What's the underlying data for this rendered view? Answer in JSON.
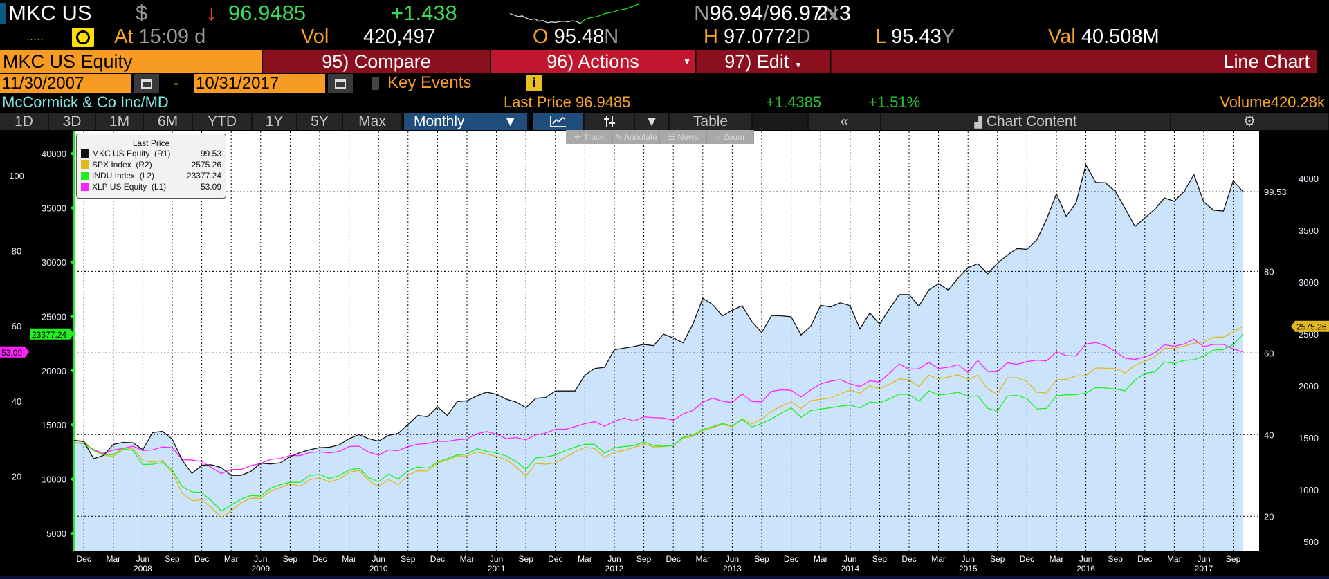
{
  "header": {
    "ticker": "MKC US",
    "currency": "$",
    "direction_arrow": "↓",
    "last": "96.9485",
    "change": "+1.438",
    "bid_ask_prefix": "N",
    "bid": "96.94",
    "sep": "/",
    "ask": "96.97",
    "bid_ask_suffix": "N",
    "size_a": "2",
    "size_x": "x",
    "size_b": "3",
    "dots": ".....",
    "at_label": "At",
    "time": "15:09",
    "time_flag": "d",
    "vol_label": "Vol",
    "vol": "420,497",
    "open_label": "O",
    "open": "95.48",
    "open_flag": "N",
    "high_label": "H",
    "high": "97.0772",
    "high_flag": "D",
    "low_label": "L",
    "low": "95.43",
    "low_flag": "Y",
    "val_label": "Val",
    "val": "40.508M",
    "sparkline": [
      10,
      9,
      8,
      8.5,
      7,
      6,
      6.5,
      5,
      5.5,
      4,
      4.5,
      4.2,
      4.8,
      5,
      4.6,
      5.2,
      4.9,
      3.5,
      6,
      7,
      7.5,
      8,
      9,
      10,
      10.5,
      11,
      12,
      12.5,
      13,
      14,
      15,
      16
    ]
  },
  "menu": {
    "security": "MKC US Equity",
    "compare": "95) Compare",
    "actions": "96) Actions",
    "edit": "97) Edit",
    "chart_type": "Line Chart"
  },
  "range": {
    "start": "11/30/2007",
    "dash": "-",
    "end": "10/31/2017",
    "key_events": "Key Events",
    "info": "i"
  },
  "summary": {
    "name": "McCormick & Co Inc/MD",
    "last_price_label": "Last Price",
    "last_price": "96.9485",
    "change": "+1.4385",
    "change_pct": "+1.51%",
    "volume_label": "Volume",
    "volume": "420.28k"
  },
  "toolbar": {
    "periods": [
      "1D",
      "3D",
      "1M",
      "6M",
      "YTD",
      "1Y",
      "5Y",
      "Max"
    ],
    "frequency": "Monthly",
    "table": "Table",
    "collapse": "«",
    "chart_content": "Chart Content"
  },
  "mini_toolbar": {
    "track": "Track",
    "annotate": "Annotate",
    "news": "News",
    "zoom": "Zoom"
  },
  "colors": {
    "mkc": "#111111",
    "spx": "#e0b820",
    "indu": "#22ee22",
    "xlp": "#ff22ff",
    "fill": "#cce4fb",
    "accent_orange": "#f89b22"
  },
  "chart_data": {
    "type": "line",
    "x_start": "2007-11",
    "frequency": "monthly",
    "x_tick_labels": [
      "Dec",
      "Mar",
      "Jun",
      "Sep",
      "Dec",
      "Mar",
      "Jun",
      "Sep",
      "Dec",
      "Mar",
      "Jun",
      "Sep",
      "Dec",
      "Mar",
      "Jun",
      "Sep",
      "Dec",
      "Mar",
      "Jun",
      "Sep",
      "Dec",
      "Mar",
      "Jun",
      "Sep",
      "Dec",
      "Mar",
      "Jun",
      "Sep",
      "Dec",
      "Mar",
      "Jun",
      "Sep",
      "Dec",
      "Mar",
      "Jun",
      "Sep",
      "Dec",
      "Mar",
      "Jun",
      "Sep"
    ],
    "year_labels": [
      "2008",
      "2009",
      "2010",
      "2011",
      "2012",
      "2013",
      "2014",
      "2015",
      "2016",
      "2017"
    ],
    "legend_title": "Last Price",
    "axes": {
      "L1": {
        "range": [
          0,
          111.8
        ],
        "ticks": [
          "20",
          "40",
          "60",
          "80",
          "100"
        ]
      },
      "L2": {
        "range": [
          3350,
          42040
        ],
        "ticks": [
          "5000",
          "10000",
          "15000",
          "20000",
          "25000",
          "30000",
          "35000",
          "40000"
        ]
      },
      "R1": {
        "range": [
          11.4,
          114.3
        ],
        "ticks": [
          "20",
          "40",
          "60",
          "80"
        ]
      },
      "R2": {
        "range": [
          407,
          4453
        ],
        "ticks": [
          "500",
          "1000",
          "1500",
          "2000",
          "2500",
          "3000",
          "3500",
          "4000"
        ]
      }
    },
    "series": [
      {
        "name": "MKC US Equity",
        "axis_label": "(R1)",
        "axis": "R1",
        "last": "99.53",
        "color_key": "mkc",
        "fill": true,
        "values": [
          38.6,
          38.3,
          34.1,
          34.9,
          37.6,
          38.1,
          38.0,
          36.3,
          40.5,
          40.8,
          38.9,
          33.8,
          30.5,
          32.5,
          32.6,
          31.9,
          30.0,
          30.0,
          31.0,
          33.0,
          32.8,
          33.1,
          34.6,
          35.6,
          36.3,
          36.8,
          36.9,
          37.5,
          39.0,
          40.0,
          39.0,
          38.4,
          39.8,
          40.3,
          42.5,
          44.7,
          44.4,
          46.8,
          44.7,
          48.1,
          48.3,
          49.5,
          50.4,
          49.9,
          48.7,
          48.0,
          46.6,
          48.9,
          49.1,
          50.7,
          50.7,
          50.7,
          54.6,
          56.2,
          56.5,
          60.8,
          61.2,
          61.6,
          62.1,
          61.8,
          64.6,
          63.7,
          62.5,
          67.1,
          73.4,
          71.9,
          69.1,
          70.5,
          71.6,
          67.7,
          65.0,
          69.2,
          69.1,
          68.9,
          64.4,
          66.6,
          71.7,
          71.3,
          72.3,
          71.6,
          65.9,
          69.8,
          67.1,
          70.8,
          74.3,
          74.3,
          71.5,
          75.4,
          77.0,
          75.4,
          78.4,
          80.9,
          81.9,
          79.4,
          82.0,
          84.0,
          85.6,
          85.4,
          87.7,
          92.8,
          99.0,
          93.5,
          96.8,
          106.1,
          101.8,
          101.7,
          99.6,
          95.4,
          91.0,
          93.1,
          95.2,
          98.0,
          97.2,
          99.6,
          103.7,
          97.0,
          95.0,
          94.8,
          102.2,
          99.53
        ]
      },
      {
        "name": "SPX Index",
        "axis_label": "(R2)",
        "axis": "R2",
        "last": "2575.26",
        "color_key": "spx",
        "values": [
          1481,
          1468,
          1379,
          1331,
          1323,
          1386,
          1400,
          1280,
          1267,
          1283,
          1165,
          969,
          896,
          903,
          826,
          735,
          798,
          873,
          919,
          919,
          987,
          1021,
          1057,
          1036,
          1096,
          1115,
          1074,
          1104,
          1169,
          1187,
          1089,
          1031,
          1102,
          1049,
          1141,
          1183,
          1181,
          1258,
          1286,
          1327,
          1326,
          1364,
          1345,
          1321,
          1292,
          1219,
          1131,
          1253,
          1247,
          1258,
          1312,
          1366,
          1408,
          1398,
          1310,
          1362,
          1379,
          1407,
          1441,
          1412,
          1416,
          1426,
          1498,
          1515,
          1569,
          1598,
          1631,
          1606,
          1686,
          1633,
          1682,
          1757,
          1806,
          1848,
          1783,
          1859,
          1872,
          1884,
          1924,
          1960,
          1931,
          2003,
          1972,
          2018,
          2068,
          2059,
          1995,
          2105,
          2068,
          2086,
          2107,
          2063,
          2104,
          1972,
          1920,
          2079,
          2080,
          2044,
          1940,
          1932,
          2060,
          2065,
          2097,
          2099,
          2174,
          2171,
          2168,
          2126,
          2199,
          2239,
          2279,
          2364,
          2363,
          2384,
          2412,
          2423,
          2470,
          2472,
          2519,
          2575.26
        ]
      },
      {
        "name": "INDU Index",
        "axis_label": "(L2)",
        "axis": "L2",
        "last": "23377.24",
        "color_key": "indu",
        "values": [
          13372,
          13265,
          12650,
          12266,
          12263,
          12820,
          12638,
          11350,
          11378,
          11544,
          10851,
          9325,
          8829,
          8776,
          8001,
          7063,
          7609,
          8168,
          8500,
          8447,
          9172,
          9496,
          9712,
          9713,
          10345,
          10428,
          10067,
          10325,
          10857,
          11009,
          10137,
          9774,
          10466,
          10015,
          10788,
          11118,
          11006,
          11578,
          11892,
          12226,
          12320,
          12811,
          12570,
          12414,
          12143,
          11614,
          10913,
          11955,
          12046,
          12218,
          12633,
          12952,
          13212,
          13214,
          12393,
          12880,
          13009,
          13091,
          13437,
          13096,
          13026,
          13104,
          13861,
          14054,
          14579,
          14840,
          15116,
          14910,
          15500,
          14810,
          15130,
          15546,
          16086,
          16577,
          15699,
          16322,
          16458,
          16581,
          16717,
          16827,
          16563,
          17098,
          17043,
          17391,
          17828,
          17823,
          17165,
          18133,
          17776,
          17841,
          18011,
          17620,
          17690,
          16528,
          16285,
          17664,
          17720,
          17425,
          16466,
          16517,
          17685,
          17774,
          17787,
          17930,
          18432,
          18401,
          18308,
          18142,
          19124,
          19763,
          19864,
          20812,
          20663,
          20941,
          21009,
          21350,
          21891,
          21948,
          22405,
          23377.24
        ]
      },
      {
        "name": "XLP US Equity",
        "axis_label": "(L1)",
        "axis": "L1",
        "last": "53.09",
        "color_key": "xlp",
        "values": [
          28.9,
          28.8,
          27.1,
          26.1,
          27.0,
          27.4,
          28.0,
          26.8,
          27.0,
          27.8,
          27.6,
          24.4,
          24.3,
          23.9,
          22.3,
          20.7,
          21.8,
          21.8,
          22.8,
          23.4,
          24.5,
          24.7,
          25.5,
          25.5,
          26.3,
          26.5,
          26.2,
          26.6,
          27.9,
          28.0,
          26.4,
          25.6,
          27.0,
          26.8,
          27.9,
          28.5,
          28.7,
          29.3,
          29.3,
          29.7,
          29.9,
          31.3,
          31.9,
          31.2,
          30.0,
          30.3,
          29.7,
          31.0,
          31.5,
          32.5,
          32.5,
          33.2,
          34.0,
          34.5,
          33.3,
          34.6,
          35.5,
          34.7,
          35.8,
          35.6,
          35.5,
          34.9,
          36.6,
          37.5,
          39.7,
          40.8,
          40.0,
          39.6,
          41.9,
          39.9,
          39.8,
          42.6,
          43.0,
          42.9,
          41.1,
          43.0,
          44.6,
          45.3,
          45.7,
          44.6,
          43.9,
          45.4,
          45.1,
          47.4,
          49.9,
          48.5,
          48.6,
          50.3,
          48.7,
          49.0,
          49.7,
          47.6,
          50.8,
          47.9,
          47.8,
          50.2,
          49.8,
          50.5,
          50.9,
          50.7,
          53.1,
          52.1,
          52.0,
          55.2,
          55.6,
          54.8,
          53.2,
          51.4,
          51.1,
          51.7,
          52.8,
          55.0,
          54.6,
          55.2,
          56.5,
          54.5,
          55.1,
          55.1,
          53.9,
          53.09
        ]
      }
    ]
  }
}
